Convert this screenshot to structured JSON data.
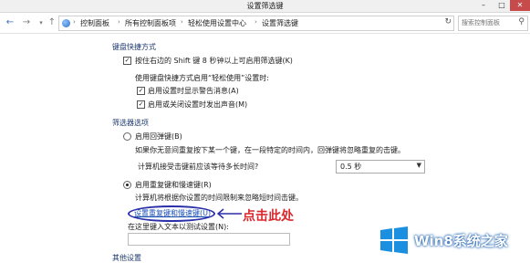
{
  "window": {
    "title": "设置筛选键",
    "min_label": "–",
    "max_label": "□",
    "close_label": "✕"
  },
  "nav": {
    "back_icon": "back-arrow-icon",
    "forward_icon": "forward-arrow-icon",
    "up_icon": "up-arrow-icon",
    "breadcrumbs": [
      "控制面板",
      "所有控制面板项",
      "轻松使用设置中心",
      "设置筛选键"
    ],
    "search_placeholder": "搜索控制面板"
  },
  "keyboard_shortcut": {
    "section_title": "键盘快捷方式",
    "toggle_label": "按住右边的 Shift 键 8 秒钟以上可启用筛选键(K)",
    "toggle_checked": true,
    "note": "使用键盘快捷方式启用“轻松使用”设置时:",
    "warn_label": "启用设置时显示警告消息(A)",
    "warn_checked": true,
    "sound_label": "启用或关闭设置时发出声音(M)",
    "sound_checked": true
  },
  "filter_options": {
    "section_title": "筛选器选项",
    "bounce_label": "启用回弹键(B)",
    "bounce_selected": false,
    "bounce_desc": "如果你无意间重复按下某一个键，在一段特定的时间内，回弹键将忽略重复的击键。",
    "wait_label": "计算机接受击键前应该等待多长时间?",
    "wait_value": "0.5 秒",
    "repeat_label": "启用重复键和慢速键(R)",
    "repeat_selected": true,
    "repeat_desc": "计算机将根据你设置的时间限制来忽略短时间击键。",
    "repeat_link": "设置重复键和慢速键(U)",
    "test_label": "在这里键入文本以测试设置(N):",
    "test_value": "",
    "more_title": "其他设置"
  },
  "annotation": {
    "callout_text": "点击此处",
    "color": "#d8282e"
  },
  "watermark": {
    "text": "Win8系统之家"
  },
  "colors": {
    "accent": "#1a4fb3",
    "oval": "#2b2fa8",
    "close": "#c74b4b"
  }
}
